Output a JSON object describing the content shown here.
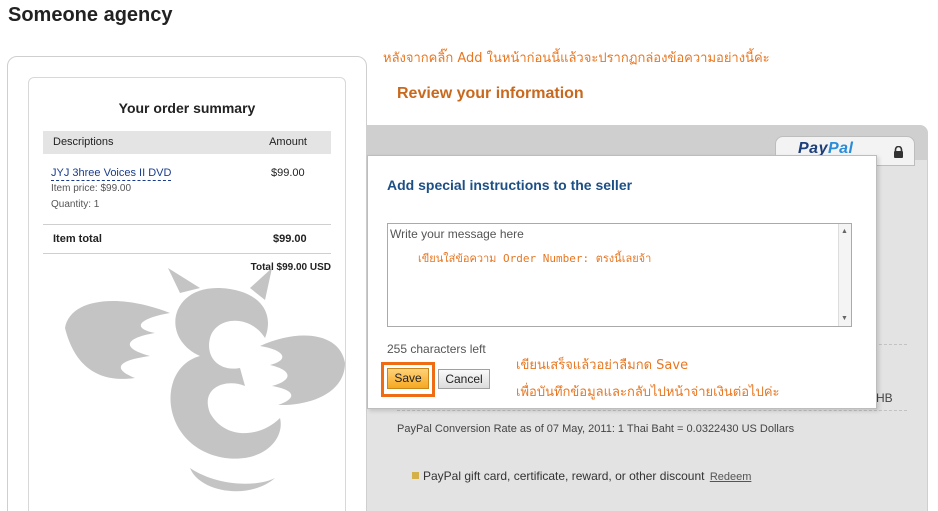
{
  "header": {
    "title": "Someone agency"
  },
  "annotations": {
    "top": "หลังจากคลิ๊ก Add ในหน้าก่อนนี้แล้วจะปรากฏกล่องข้อความอย่างนี้ค่ะ",
    "save_line1": "เขียนเสร็จแล้วอย่าลืมกด Save",
    "save_line2": "เพื่อบันทึกข้อมูลและกลับไปหน้าจ่ายเงินต่อไปค่ะ"
  },
  "review_heading": "Review your information",
  "order_summary": {
    "title": "Your order summary",
    "columns": [
      "Descriptions",
      "Amount"
    ],
    "item": {
      "name": "JYJ 3hree Voices II DVD",
      "amount": "$99.00",
      "price": "Item price: $99.00",
      "quantity": "Quantity: 1"
    },
    "item_total_label": "Item total",
    "item_total_value": "$99.00",
    "grand_total": "Total $99.00 USD"
  },
  "paypal": {
    "logo_pay": "Pay",
    "logo_pal": "Pal",
    "thb_fragment": "HB",
    "conversion_text": "PayPal Conversion Rate as of 07 May, 2011: 1 Thai Baht = 0.0322430 US Dollars",
    "gift_text": "PayPal gift card, certificate, reward, or other discount",
    "redeem_link": "Redeem"
  },
  "modal": {
    "title": "Add special instructions to the seller",
    "placeholder": "Write your message here",
    "message_note": "เขียนใส่ข้อความ Order Number: ตรงนี้เลยจ้า",
    "chars_left": "255 characters left",
    "save_label": "Save",
    "cancel_label": "Cancel"
  },
  "colors": {
    "annotation_orange": "#e87722",
    "highlight_orange": "#ef6b14",
    "modal_title_blue": "#1c4f86",
    "link_blue": "#1b3c8c"
  }
}
